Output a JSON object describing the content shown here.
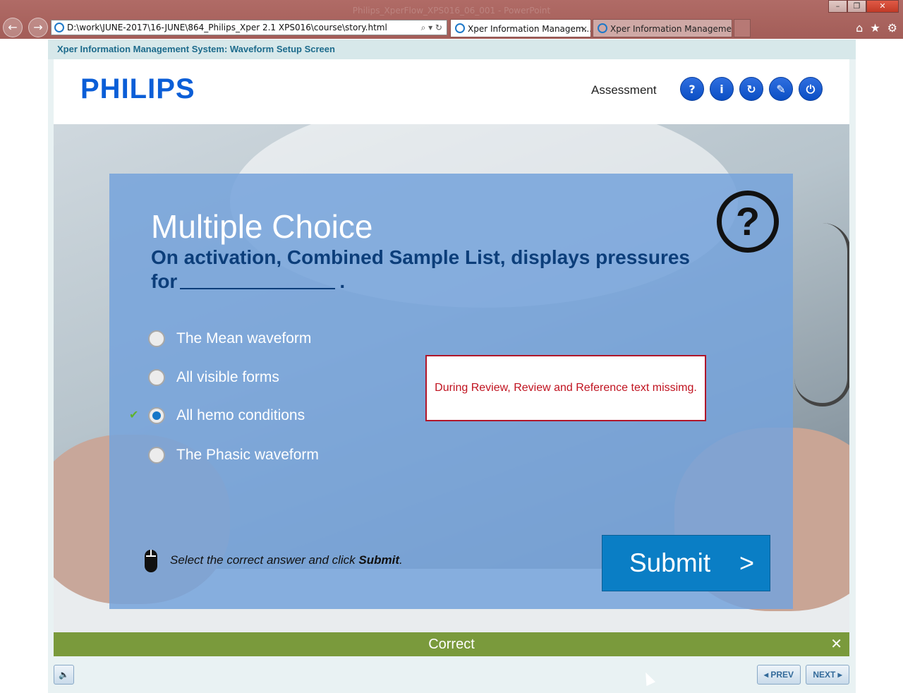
{
  "browser": {
    "window_title": "Philips_XperFlow_XPS016_06_001 - PowerPoint",
    "address": "D:\\work\\JUNE-2017\\16-JUNE\\864_Philips_Xper 2.1 XPS016\\course\\story.html",
    "tabs": [
      {
        "label": "Xper Information Managem..."
      },
      {
        "label": "Xper Information Managemen..."
      }
    ],
    "tab_close": "×",
    "controls": {
      "minimize": "–",
      "restore": "❐",
      "close": "✕",
      "back": "←",
      "forward": "→"
    },
    "address_tools": "⌕ ▾ ↻",
    "toolbar_icons": {
      "home": "⌂",
      "favorites": "★",
      "settings": "⚙"
    }
  },
  "course": {
    "title": "Xper Information Management System: Waveform Setup Screen",
    "logo": "PHILIPS",
    "assessment_label": "Assessment",
    "header_buttons": [
      {
        "name": "help",
        "glyph": "?"
      },
      {
        "name": "info",
        "glyph": "i"
      },
      {
        "name": "replay",
        "glyph": "↻"
      },
      {
        "name": "glossary",
        "glyph": "✎"
      },
      {
        "name": "exit",
        "glyph": "⏻"
      }
    ]
  },
  "quiz": {
    "heading": "Multiple Choice",
    "question_part1": "On activation, Combined Sample List, displays pressures for",
    "question_end": ".",
    "help_glyph": "?",
    "options": [
      {
        "label": "The Mean waveform",
        "selected": false
      },
      {
        "label": "All visible forms",
        "selected": false
      },
      {
        "label": "All hemo conditions",
        "selected": true
      },
      {
        "label": "The Phasic waveform",
        "selected": false
      }
    ],
    "correct_mark": "✔",
    "review_note": "During Review,  Review and Reference text missimg.",
    "instruction_prefix": "Select the correct answer and click ",
    "instruction_bold": "Submit",
    "instruction_suffix": ".",
    "submit_label": "Submit",
    "submit_arrow": ">"
  },
  "feedback": {
    "label": "Correct",
    "close_glyph": "✕"
  },
  "footer": {
    "audio_glyph": "🔈",
    "prev_label": "◂ PREV",
    "next_label": "NEXT ▸"
  }
}
